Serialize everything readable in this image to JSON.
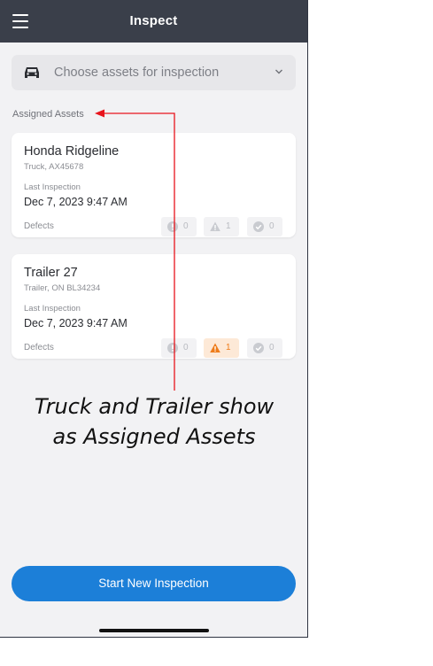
{
  "header": {
    "title": "Inspect"
  },
  "asset_selector": {
    "placeholder": "Choose assets for inspection",
    "icon": "car-icon"
  },
  "section": {
    "label": "Assigned Assets"
  },
  "assets": [
    {
      "name": "Honda Ridgeline",
      "sub": "Truck, AX45678",
      "last_inspection_label": "Last Inspection",
      "last_inspection_date": "Dec 7, 2023 9:47 AM",
      "defects_label": "Defects",
      "defects": {
        "major": "0",
        "minor": "1",
        "resolved": "0"
      }
    },
    {
      "name": "Trailer 27",
      "sub": "Trailer, ON BL34234",
      "last_inspection_label": "Last Inspection",
      "last_inspection_date": "Dec 7, 2023 9:47 AM",
      "defects_label": "Defects",
      "defects": {
        "major": "0",
        "minor": "1",
        "resolved": "0"
      }
    }
  ],
  "annotation": {
    "text": "Truck and Trailer show as Assigned Assets",
    "arrow_color": "#e8141c"
  },
  "start_button": {
    "label": "Start New Inspection"
  },
  "colors": {
    "header_bg": "#3a3f4a",
    "accent": "#1c7fd8",
    "warning": "#ee7c1a",
    "page_bg": "#f2f2f4"
  }
}
